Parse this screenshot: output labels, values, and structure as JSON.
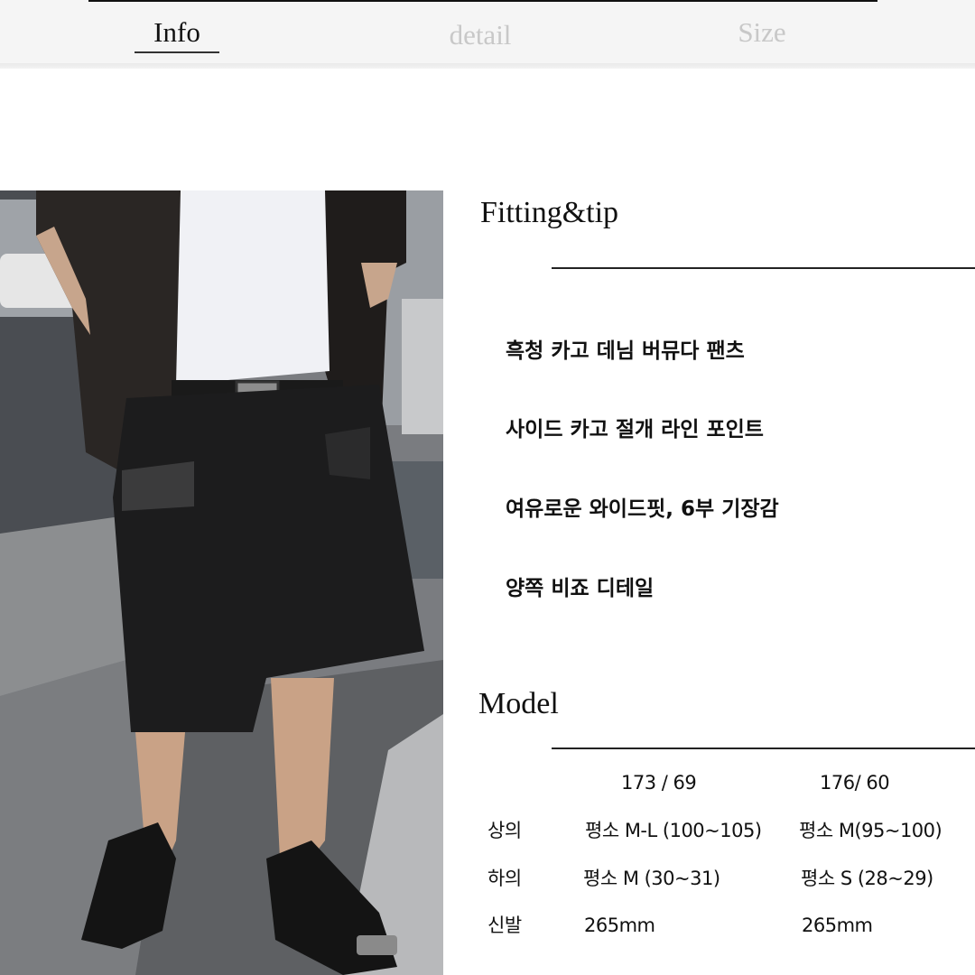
{
  "tabs": [
    {
      "label": "Info",
      "active": true
    },
    {
      "label": "detail",
      "active": false
    },
    {
      "label": "Size",
      "active": false
    }
  ],
  "colors": {
    "tab_active": "#111111",
    "tab_inactive": "#c8c8c8",
    "tabbar_bg": "#f5f5f5"
  },
  "photo": {
    "description": "Model wearing black cargo denim bermuda shorts, white t-shirt, black knit cardigan, braided belt and black fisherman sandals on a street"
  },
  "fitting": {
    "title": "Fitting&tip",
    "tips": [
      "흑청 카고 데님 버뮤다 팬츠",
      "사이드 카고 절개 라인 포인트",
      "여유로운 와이드핏, 6부 기장감",
      "양쪽 비죠 디테일"
    ]
  },
  "model": {
    "title": "Model",
    "columns": [
      "173 / 69",
      "176/ 60"
    ],
    "rows": [
      {
        "label": "상의",
        "values": [
          "평소 M-L (100~105)",
          "평소 M(95~100)"
        ]
      },
      {
        "label": "하의",
        "values": [
          "평소 M (30~31)",
          "평소 S (28~29)"
        ]
      },
      {
        "label": "신발",
        "values": [
          "265mm",
          "265mm"
        ]
      }
    ]
  }
}
